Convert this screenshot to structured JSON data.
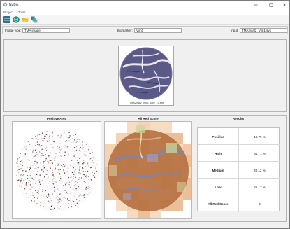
{
  "window": {
    "title": "NuBis",
    "controls": [
      "minimize-icon",
      "maximize-icon",
      "close-icon"
    ]
  },
  "menu": {
    "items": [
      "Project",
      "Tools"
    ]
  },
  "toolbar": {
    "tools": [
      {
        "icon": "grid-icon",
        "color": "#2e6f8f"
      },
      {
        "icon": "target-icon",
        "color": "#1e8f7b"
      },
      {
        "icon": "folder-icon",
        "color": "#e1b12c"
      },
      {
        "icon": "layers-icon",
        "color": "#5b8fb9"
      }
    ]
  },
  "fields": {
    "image_type_label": "Image type:",
    "image_type_value": "TMA image",
    "biomarker_label": "Biomarker:",
    "biomarker_value": "Vim1",
    "input_label": "Input:",
    "input_value": "TMA2vial2_Vim1.svs"
  },
  "thumbnail": {
    "caption": "TMA2Vial2_Vim1_core_10.png"
  },
  "sections": {
    "positive_area": "Positive Area",
    "all_red_score": "All Red Score",
    "results": "Results"
  },
  "results": [
    {
      "label": "Positive",
      "value": "10.79 %"
    },
    {
      "label": "High",
      "value": "34.71 %"
    },
    {
      "label": "Medium",
      "value": "40.12 %"
    },
    {
      "label": "Low",
      "value": "25.17 %"
    },
    {
      "label": "All Red Score",
      "value": "4"
    }
  ]
}
